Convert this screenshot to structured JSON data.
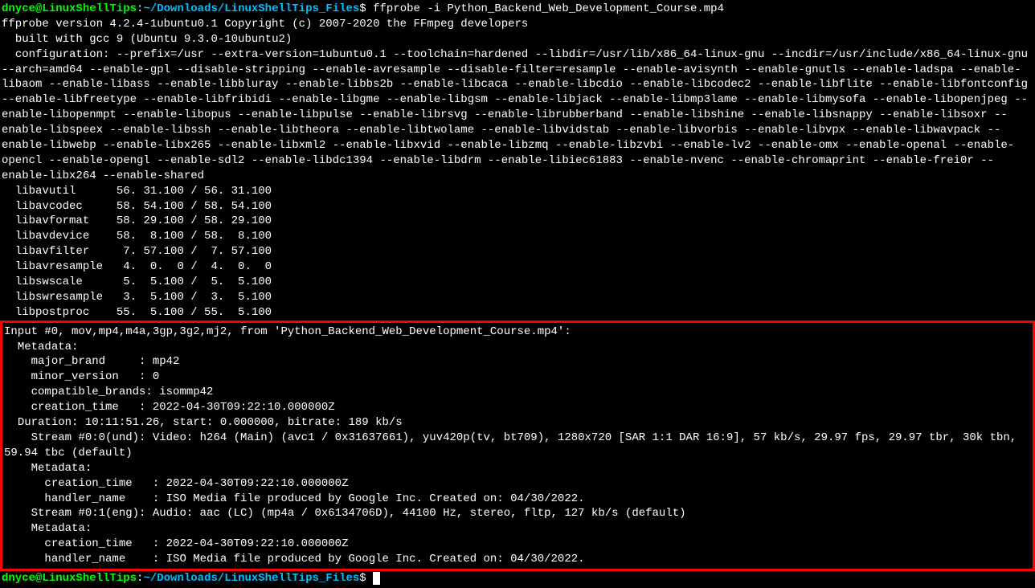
{
  "prompt1": {
    "user": "dnyce",
    "at": "@",
    "host": "LinuxShellTips",
    "colon": ":",
    "path": "~/Downloads/LinuxShellTips_Files",
    "dollar": "$ ",
    "command": "ffprobe -i Python_Backend_Web_Development_Course.mp4"
  },
  "output": {
    "line1": "ffprobe version 4.2.4-1ubuntu0.1 Copyright (c) 2007-2020 the FFmpeg developers",
    "line2": "  built with gcc 9 (Ubuntu 9.3.0-10ubuntu2)",
    "line3": "  configuration: --prefix=/usr --extra-version=1ubuntu0.1 --toolchain=hardened --libdir=/usr/lib/x86_64-linux-gnu --incdir=/usr/include/x86_64-linux-gnu --arch=amd64 --enable-gpl --disable-stripping --enable-avresample --disable-filter=resample --enable-avisynth --enable-gnutls --enable-ladspa --enable-libaom --enable-libass --enable-libbluray --enable-libbs2b --enable-libcaca --enable-libcdio --enable-libcodec2 --enable-libflite --enable-libfontconfig --enable-libfreetype --enable-libfribidi --enable-libgme --enable-libgsm --enable-libjack --enable-libmp3lame --enable-libmysofa --enable-libopenjpeg --enable-libopenmpt --enable-libopus --enable-libpulse --enable-librsvg --enable-librubberband --enable-libshine --enable-libsnappy --enable-libsoxr --enable-libspeex --enable-libssh --enable-libtheora --enable-libtwolame --enable-libvidstab --enable-libvorbis --enable-libvpx --enable-libwavpack --enable-libwebp --enable-libx265 --enable-libxml2 --enable-libxvid --enable-libzmq --enable-libzvbi --enable-lv2 --enable-omx --enable-openal --enable-opencl --enable-opengl --enable-sdl2 --enable-libdc1394 --enable-libdrm --enable-libiec61883 --enable-nvenc --enable-chromaprint --enable-frei0r --enable-libx264 --enable-shared",
    "lib1": "  libavutil      56. 31.100 / 56. 31.100",
    "lib2": "  libavcodec     58. 54.100 / 58. 54.100",
    "lib3": "  libavformat    58. 29.100 / 58. 29.100",
    "lib4": "  libavdevice    58.  8.100 / 58.  8.100",
    "lib5": "  libavfilter     7. 57.100 /  7. 57.100",
    "lib6": "  libavresample   4.  0.  0 /  4.  0.  0",
    "lib7": "  libswscale      5.  5.100 /  5.  5.100",
    "lib8": "  libswresample   3.  5.100 /  3.  5.100",
    "lib9": "  libpostproc    55.  5.100 / 55.  5.100"
  },
  "boxed": {
    "line1": "Input #0, mov,mp4,m4a,3gp,3g2,mj2, from 'Python_Backend_Web_Development_Course.mp4':",
    "line2": "  Metadata:",
    "line3": "    major_brand     : mp42",
    "line4": "    minor_version   : 0",
    "line5": "    compatible_brands: isommp42",
    "line6": "    creation_time   : 2022-04-30T09:22:10.000000Z",
    "line7": "  Duration: 10:11:51.26, start: 0.000000, bitrate: 189 kb/s",
    "line8": "    Stream #0:0(und): Video: h264 (Main) (avc1 / 0x31637661), yuv420p(tv, bt709), 1280x720 [SAR 1:1 DAR 16:9], 57 kb/s, 29.97 fps, 29.97 tbr, 30k tbn, 59.94 tbc (default)",
    "line9": "    Metadata:",
    "line10": "      creation_time   : 2022-04-30T09:22:10.000000Z",
    "line11": "      handler_name    : ISO Media file produced by Google Inc. Created on: 04/30/2022.",
    "line12": "    Stream #0:1(eng): Audio: aac (LC) (mp4a / 0x6134706D), 44100 Hz, stereo, fltp, 127 kb/s (default)",
    "line13": "    Metadata:",
    "line14": "      creation_time   : 2022-04-30T09:22:10.000000Z",
    "line15": "      handler_name    : ISO Media file produced by Google Inc. Created on: 04/30/2022."
  },
  "prompt2": {
    "user": "dnyce",
    "at": "@",
    "host": "LinuxShellTips",
    "colon": ":",
    "path": "~/Downloads/LinuxShellTips_Files",
    "dollar": "$ "
  }
}
